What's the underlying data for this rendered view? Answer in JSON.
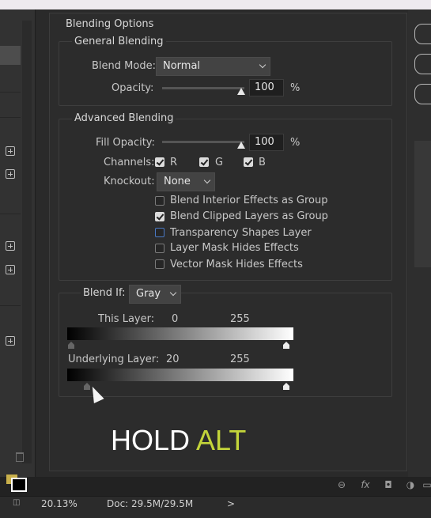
{
  "blending_options": {
    "title": "Blending Options",
    "general": {
      "title": "General Blending",
      "blend_mode_label": "Blend Mode:",
      "blend_mode_value": "Normal",
      "opacity_label": "Opacity:",
      "opacity_value": "100",
      "opacity_unit": "%"
    },
    "advanced": {
      "title": "Advanced Blending",
      "fill_opacity_label": "Fill Opacity:",
      "fill_opacity_value": "100",
      "fill_opacity_unit": "%",
      "channels_label": "Channels:",
      "channels": [
        {
          "label": "R",
          "checked": true
        },
        {
          "label": "G",
          "checked": true
        },
        {
          "label": "B",
          "checked": true
        }
      ],
      "knockout_label": "Knockout:",
      "knockout_value": "None",
      "options": [
        {
          "label": "Blend Interior Effects as Group",
          "checked": false
        },
        {
          "label": "Blend Clipped Layers as Group",
          "checked": true
        },
        {
          "label": "Transparency Shapes Layer",
          "checked": false
        },
        {
          "label": "Layer Mask Hides Effects",
          "checked": false
        },
        {
          "label": "Vector Mask Hides Effects",
          "checked": false
        }
      ]
    },
    "blend_if": {
      "label": "Blend If:",
      "value": "Gray",
      "this_layer_label": "This Layer:",
      "this_layer_low": "0",
      "this_layer_high": "255",
      "underlying_label": "Underlying Layer:",
      "underlying_low": "20",
      "underlying_high": "255"
    }
  },
  "caption": {
    "part1": "HOLD",
    "part2": "ALT",
    "accent": "#c3d43a"
  },
  "status": {
    "zoom": "20.13%",
    "doc": "Doc: 29.5M/29.5M",
    "arrow": ">"
  },
  "toolbar_icons": [
    "link-icon",
    "fx-icon",
    "mask-icon",
    "adjustment-icon",
    "folder-icon"
  ]
}
